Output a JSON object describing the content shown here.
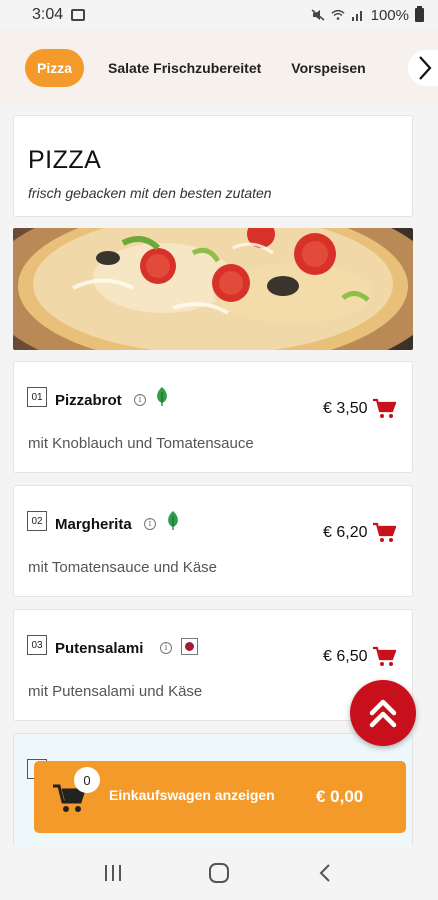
{
  "status": {
    "time": "3:04",
    "battery": "100%"
  },
  "tabs": [
    {
      "label": "Pizza",
      "active": true
    },
    {
      "label": "Salate Frischzubereitet",
      "active": false
    },
    {
      "label": "Vorspeisen",
      "active": false
    }
  ],
  "category": {
    "title": "PIZZA",
    "subtitle": "frisch gebacken mit den besten zutaten"
  },
  "items": [
    {
      "number": "01",
      "name": "Pizzabrot",
      "badge": "vegetarian-leaf",
      "price": "€ 3,50",
      "description": "mit Knoblauch und Tomatensauce"
    },
    {
      "number": "02",
      "name": "Margherita",
      "badge": "vegetarian-leaf",
      "price": "€ 6,20",
      "description": "mit Tomatensauce und Käse"
    },
    {
      "number": "03",
      "name": "Putensalami",
      "badge": "meat",
      "price": "€ 6,50",
      "description": "mit Putensalami und Käse"
    }
  ],
  "cart": {
    "count": "0",
    "label": "Einkaufswagen anzeigen",
    "total": "€ 0,00"
  },
  "colors": {
    "accent": "#f39a2a",
    "cart_red": "#c8101c",
    "meat_dot": "#9e1f34",
    "leaf_green": "#2e9e4a"
  },
  "icons": [
    "gallery-icon",
    "mute-icon",
    "wifi-icon",
    "signal-icon",
    "battery-icon",
    "chevron-right-icon",
    "info-icon",
    "leaf-icon",
    "meat-icon",
    "cart-icon",
    "double-chevron-up-icon",
    "recents-icon",
    "home-icon",
    "back-icon"
  ]
}
